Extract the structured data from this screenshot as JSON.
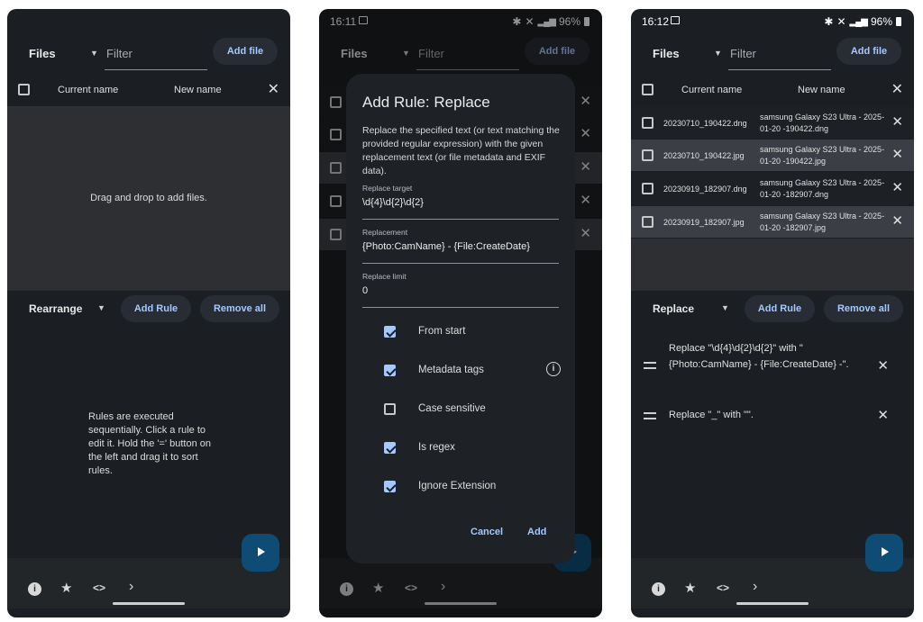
{
  "phone1": {
    "status": {
      "time": ""
    },
    "files_label": "Files",
    "filter_placeholder": "Filter",
    "add_file": "Add file",
    "header": {
      "current": "Current name",
      "new": "New name"
    },
    "drop_hint": "Drag and drop to add files.",
    "rules_mode": "Rearrange",
    "add_rule": "Add Rule",
    "remove_all": "Remove all",
    "rules_hint": "Rules are executed sequentially. Click a rule to edit it. Hold the '=' button on the left and drag it to sort rules."
  },
  "phone2": {
    "status": {
      "time": "16:11",
      "battery": "96%"
    },
    "files_label": "Files",
    "filter_placeholder": "Filter",
    "add_file": "Add file",
    "dialog": {
      "title": "Add Rule: Replace",
      "description": "Replace the specified text (or text matching the provided regular expression) with the given replacement text (or file metadata and EXIF data).",
      "fields": [
        {
          "label": "Replace target",
          "value": "\\d{4}\\d{2}\\d{2}"
        },
        {
          "label": "Replacement",
          "value": "{Photo:CamName} - {File:CreateDate}"
        },
        {
          "label": "Replace limit",
          "value": "0"
        }
      ],
      "options": [
        {
          "label": "From start",
          "checked": true
        },
        {
          "label": "Metadata tags",
          "checked": true
        },
        {
          "label": "Case sensitive",
          "checked": false
        },
        {
          "label": "Is regex",
          "checked": true
        },
        {
          "label": "Ignore Extension",
          "checked": true
        }
      ],
      "cancel": "Cancel",
      "add": "Add"
    }
  },
  "phone3": {
    "status": {
      "time": "16:12",
      "battery": "96%"
    },
    "files_label": "Files",
    "filter_placeholder": "Filter",
    "add_file": "Add file",
    "header": {
      "current": "Current name",
      "new": "New name"
    },
    "files": [
      {
        "current": "20230710_190422.dng",
        "new": "samsung Galaxy S23 Ultra - 2025-01-20 -190422.dng"
      },
      {
        "current": "20230710_190422.jpg",
        "new": "samsung Galaxy S23 Ultra - 2025-01-20 -190422.jpg"
      },
      {
        "current": "20230919_182907.dng",
        "new": "samsung Galaxy S23 Ultra - 2025-01-20 -182907.dng"
      },
      {
        "current": "20230919_182907.jpg",
        "new": "samsung Galaxy S23 Ultra - 2025-01-20 -182907.jpg"
      }
    ],
    "rules_mode": "Replace",
    "add_rule": "Add Rule",
    "remove_all": "Remove all",
    "rules": [
      {
        "text": "Replace \"\\d{4}\\d{2}\\d{2}\" with \"{Photo:CamName} - {File:CreateDate} -\"."
      },
      {
        "text": "Replace \"_\" with \"\"."
      }
    ]
  },
  "icons": {
    "info": "info-icon",
    "star": "star-icon",
    "code": "code-icon",
    "next": "chevron-right-icon",
    "run": "play-icon"
  },
  "colors": {
    "background": "#1b1e22",
    "accent": "#a5c8ff",
    "fab": "#0f4c75",
    "checkbox": "#a5c8ff"
  }
}
